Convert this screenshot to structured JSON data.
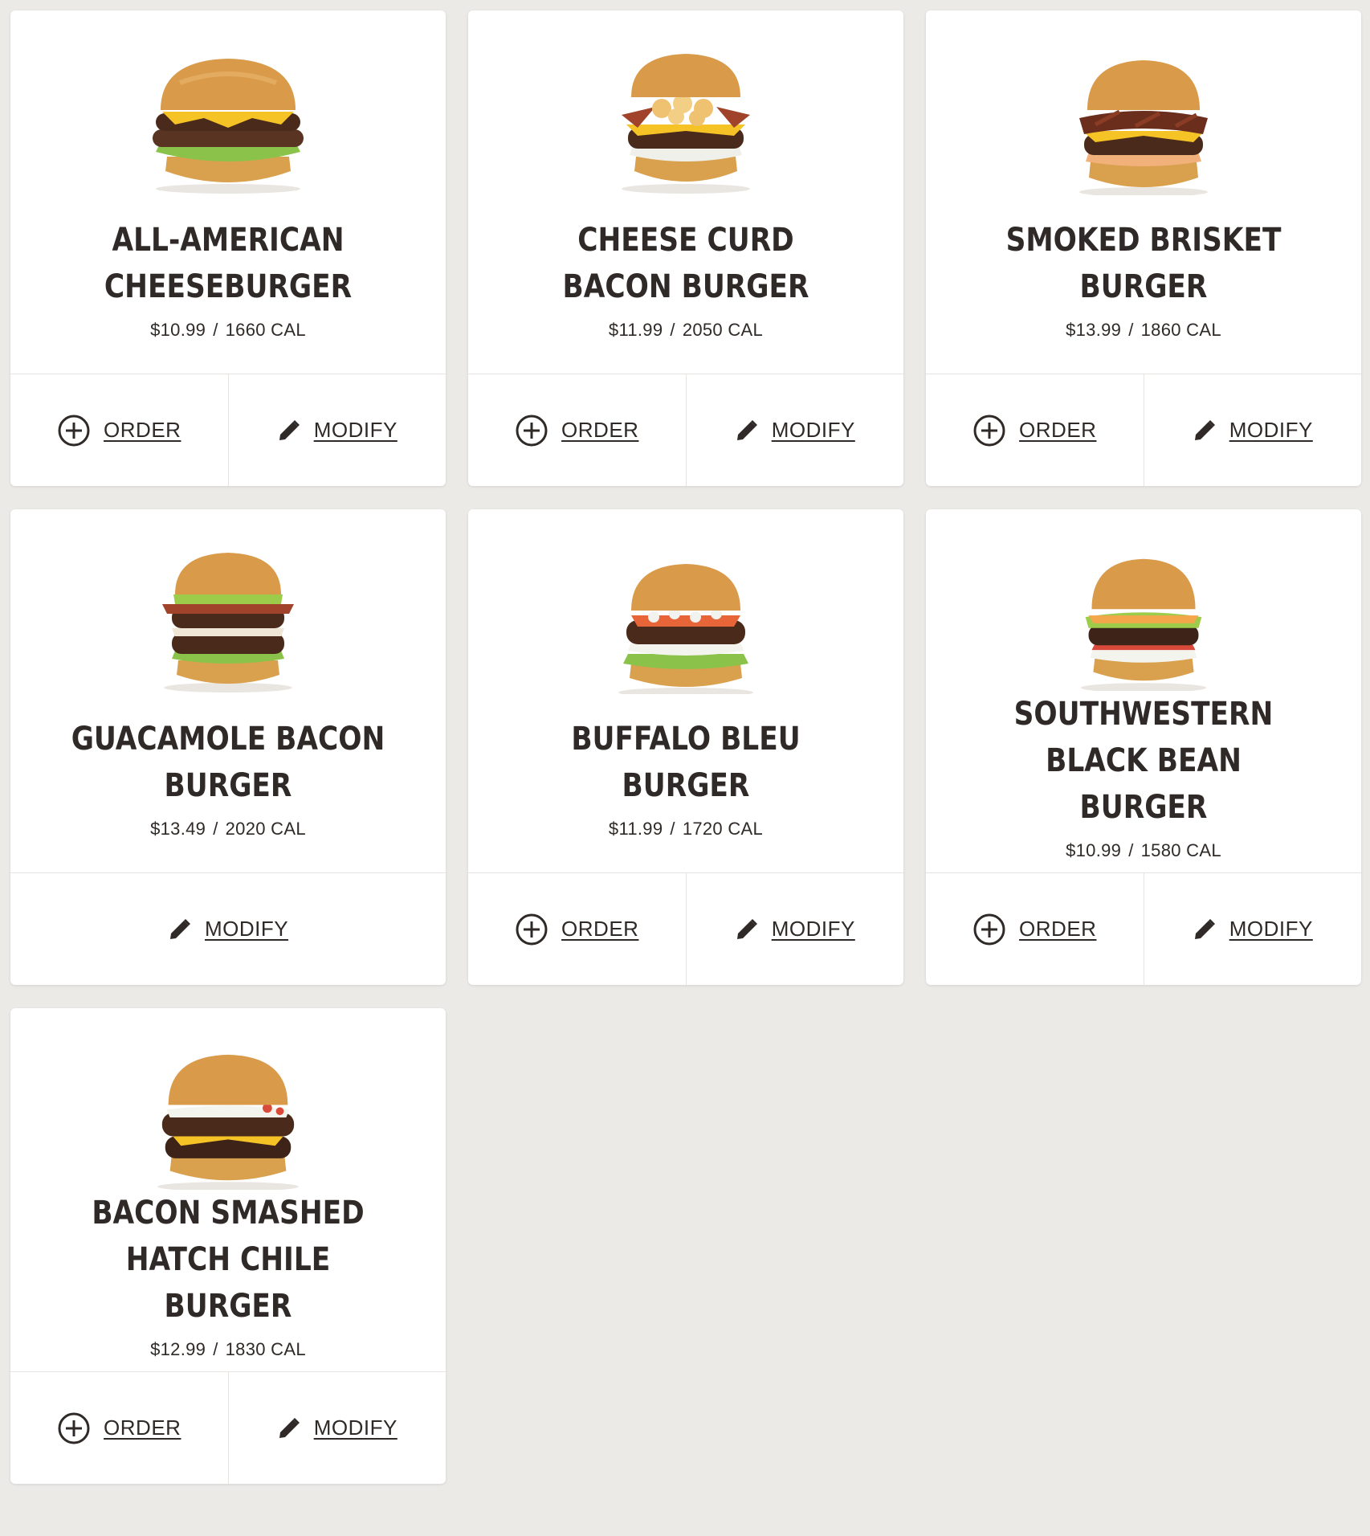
{
  "colors": {
    "background": "#eceae7",
    "card": "#ffffff",
    "text": "#2f2a27",
    "divider": "#e6e3e0"
  },
  "actions": {
    "order_label": "ORDER",
    "modify_label": "MODIFY",
    "order_icon": "plus-circle-icon",
    "modify_icon": "pencil-icon"
  },
  "items": [
    {
      "name": "ALL-AMERICAN CHEESEBURGER",
      "price": "$10.99",
      "calories": "1660 CAL"
    },
    {
      "name": "CHEESE CURD BACON BURGER",
      "price": "$11.99",
      "calories": "2050 CAL"
    },
    {
      "name": "SMOKED BRISKET BURGER",
      "price": "$13.99",
      "calories": "1860 CAL"
    },
    {
      "name": "GUACAMOLE BACON BURGER",
      "price": "$13.49",
      "calories": "2020 CAL"
    },
    {
      "name": "BUFFALO BLEU BURGER",
      "price": "$11.99",
      "calories": "1720 CAL"
    },
    {
      "name": "SOUTHWESTERN BLACK BEAN BURGER",
      "price": "$10.99",
      "calories": "1580 CAL"
    },
    {
      "name": "BACON SMASHED HATCH CHILE BURGER",
      "price": "$12.99",
      "calories": "1830 CAL"
    }
  ]
}
